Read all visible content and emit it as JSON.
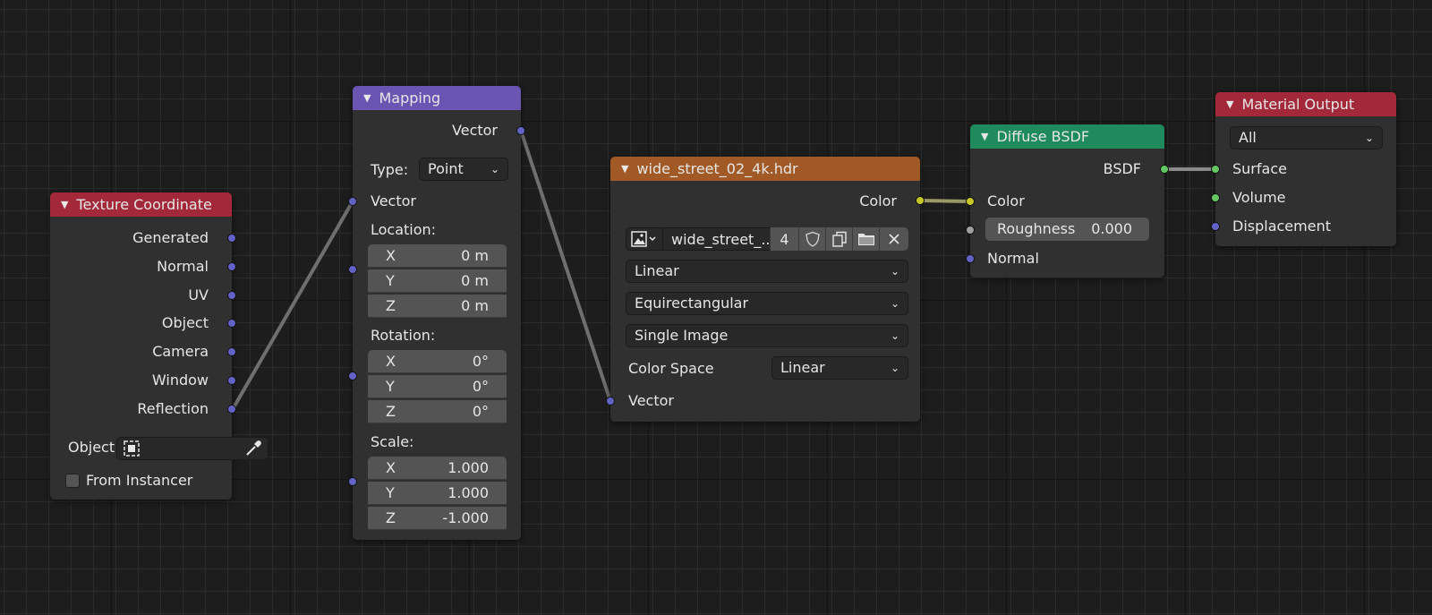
{
  "nodes": {
    "texture_coordinate": {
      "title": "Texture Coordinate",
      "header_color": "#a3293a",
      "outputs": [
        "Generated",
        "Normal",
        "UV",
        "Object",
        "Camera",
        "Window",
        "Reflection"
      ],
      "object_label": "Object:",
      "from_instancer_label": "From Instancer",
      "from_instancer_checked": false
    },
    "mapping": {
      "title": "Mapping",
      "header_color": "#6a55b3",
      "output_label": "Vector",
      "type_label": "Type:",
      "type_value": "Point",
      "input_vector_label": "Vector",
      "location_label": "Location:",
      "location": [
        {
          "axis": "X",
          "value": "0 m"
        },
        {
          "axis": "Y",
          "value": "0 m"
        },
        {
          "axis": "Z",
          "value": "0 m"
        }
      ],
      "rotation_label": "Rotation:",
      "rotation": [
        {
          "axis": "X",
          "value": "0°"
        },
        {
          "axis": "Y",
          "value": "0°"
        },
        {
          "axis": "Z",
          "value": "0°"
        }
      ],
      "scale_label": "Scale:",
      "scale": [
        {
          "axis": "X",
          "value": "1.000"
        },
        {
          "axis": "Y",
          "value": "1.000"
        },
        {
          "axis": "Z",
          "value": "-1.000"
        }
      ]
    },
    "image_texture": {
      "title": "wide_street_02_4k.hdr",
      "header_color": "#a15a25",
      "output_label": "Color",
      "image_name": "wide_street_...",
      "users_count": "4",
      "interpolation": "Linear",
      "projection": "Equirectangular",
      "source": "Single Image",
      "color_space_label": "Color Space",
      "color_space": "Linear",
      "input_vector_label": "Vector"
    },
    "diffuse_bsdf": {
      "title": "Diffuse BSDF",
      "header_color": "#1f8a5c",
      "output_label": "BSDF",
      "color_label": "Color",
      "roughness_label": "Roughness",
      "roughness_value": "0.000",
      "normal_label": "Normal"
    },
    "material_output": {
      "title": "Material Output",
      "header_color": "#a3293a",
      "target": "All",
      "surface_label": "Surface",
      "volume_label": "Volume",
      "displacement_label": "Displacement"
    }
  },
  "socket_colors": {
    "vector": "#6363c7",
    "color": "#c7c729",
    "shader": "#63c763",
    "float": "#a1a1a1"
  }
}
